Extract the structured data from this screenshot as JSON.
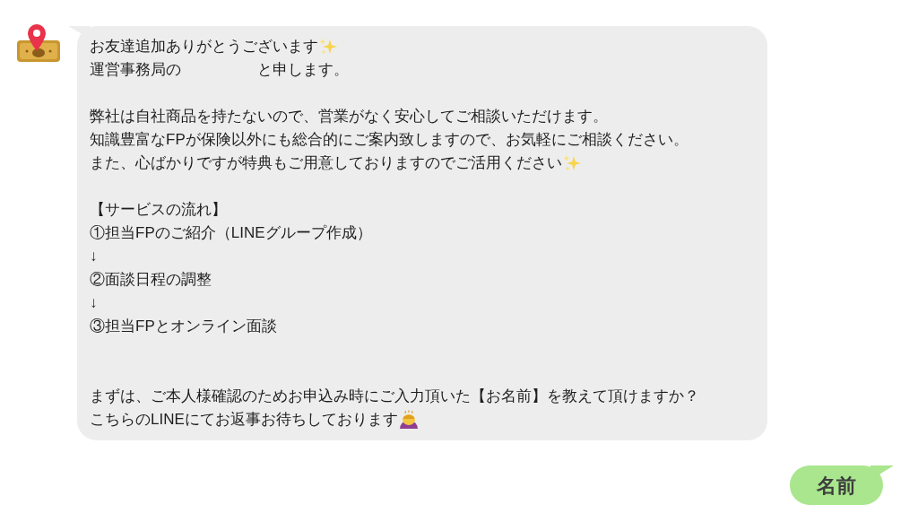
{
  "messages": [
    {
      "kind": "received",
      "lines": [
        {
          "kind": "text_sparkles",
          "text": "お友達追加ありがとうございます"
        },
        {
          "kind": "text",
          "text": "運営事務局の　　　　　と申します。"
        },
        {
          "kind": "blank"
        },
        {
          "kind": "text",
          "text": "弊社は自社商品を持たないので、営業がなく安心してご相談いただけます。"
        },
        {
          "kind": "text",
          "text": "知識豊富なFPが保険以外にも総合的にご案内致しますので、お気軽にご相談ください。"
        },
        {
          "kind": "text_sparkles",
          "text": "また、心ばかりですが特典もご用意しておりますのでご活用ください"
        },
        {
          "kind": "blank"
        },
        {
          "kind": "text",
          "text": "【サービスの流れ】"
        },
        {
          "kind": "text",
          "text": "①担当FPのご紹介（LINEグループ作成）"
        },
        {
          "kind": "text",
          "text": "↓"
        },
        {
          "kind": "text",
          "text": "②面談日程の調整"
        },
        {
          "kind": "text",
          "text": "↓"
        },
        {
          "kind": "text",
          "text": "③担当FPとオンライン面談"
        },
        {
          "kind": "blank"
        },
        {
          "kind": "blank"
        },
        {
          "kind": "text",
          "text": "まずは、ご本人様確認のためお申込み時にご入力頂いた【お名前】を教えて頂けますか？"
        },
        {
          "kind": "text_bowing",
          "text": "こちらのLINEにてお返事お待ちしております"
        }
      ]
    },
    {
      "kind": "sent",
      "text": "名前"
    }
  ]
}
